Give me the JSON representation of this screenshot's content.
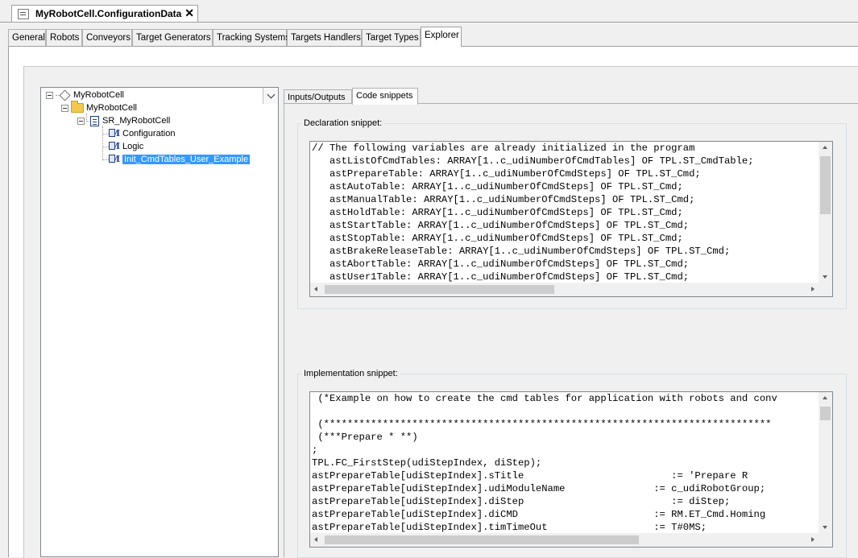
{
  "document_tab": {
    "title": "MyRobotCell.ConfigurationData",
    "close": "✕"
  },
  "page_tabs": [
    "General",
    "Robots",
    "Conveyors",
    "Target Generators",
    "Tracking Systems",
    "Targets Handlers",
    "Target Types",
    "Explorer"
  ],
  "active_page_tab": "Explorer",
  "tree": {
    "root": "MyRobotCell",
    "folder": "MyRobotCell",
    "program": "SR_MyRobotCell",
    "items": [
      "Configuration",
      "Logic",
      "Init_CmdTables_User_Example"
    ],
    "selected": "Init_CmdTables_User_Example"
  },
  "sub_tabs": [
    "Inputs/Outputs",
    "Code snippets"
  ],
  "active_sub_tab": "Code snippets",
  "declaration": {
    "label": "Declaration snippet:",
    "lines": [
      "// The following variables are already initialized in the program",
      "   astListOfCmdTables: ARRAY[1..c_udiNumberOfCmdTables] OF TPL.ST_CmdTable;",
      "   astPrepareTable: ARRAY[1..c_udiNumberOfCmdSteps] OF TPL.ST_Cmd;",
      "   astAutoTable: ARRAY[1..c_udiNumberOfCmdSteps] OF TPL.ST_Cmd;",
      "   astManualTable: ARRAY[1..c_udiNumberOfCmdSteps] OF TPL.ST_Cmd;",
      "   astHoldTable: ARRAY[1..c_udiNumberOfCmdSteps] OF TPL.ST_Cmd;",
      "   astStartTable: ARRAY[1..c_udiNumberOfCmdSteps] OF TPL.ST_Cmd;",
      "   astStopTable: ARRAY[1..c_udiNumberOfCmdSteps] OF TPL.ST_Cmd;",
      "   astBrakeReleaseTable: ARRAY[1..c_udiNumberOfCmdSteps] OF TPL.ST_Cmd;",
      "   astAbortTable: ARRAY[1..c_udiNumberOfCmdSteps] OF TPL.ST_Cmd;",
      "   astUser1Table: ARRAY[1..c_udiNumberOfCmdSteps] OF TPL.ST_Cmd;"
    ]
  },
  "implementation": {
    "label": "Implementation snippet:",
    "lines": [
      " (*Example on how to create the cmd tables for application with robots and conv",
      "",
      " (****************************************************************************",
      " (***Prepare * **)",
      ";",
      "TPL.FC_FirstStep(udiStepIndex, diStep);",
      "astPrepareTable[udiStepIndex].sTitle                         := 'Prepare R",
      "astPrepareTable[udiStepIndex].udiModuleName               := c_udiRobotGroup;",
      "astPrepareTable[udiStepIndex].diStep                         := diStep;",
      "astPrepareTable[udiStepIndex].diCMD                       := RM.ET_Cmd.Homing",
      "astPrepareTable[udiStepIndex].timTimeOut                  := T#0MS;"
    ]
  }
}
